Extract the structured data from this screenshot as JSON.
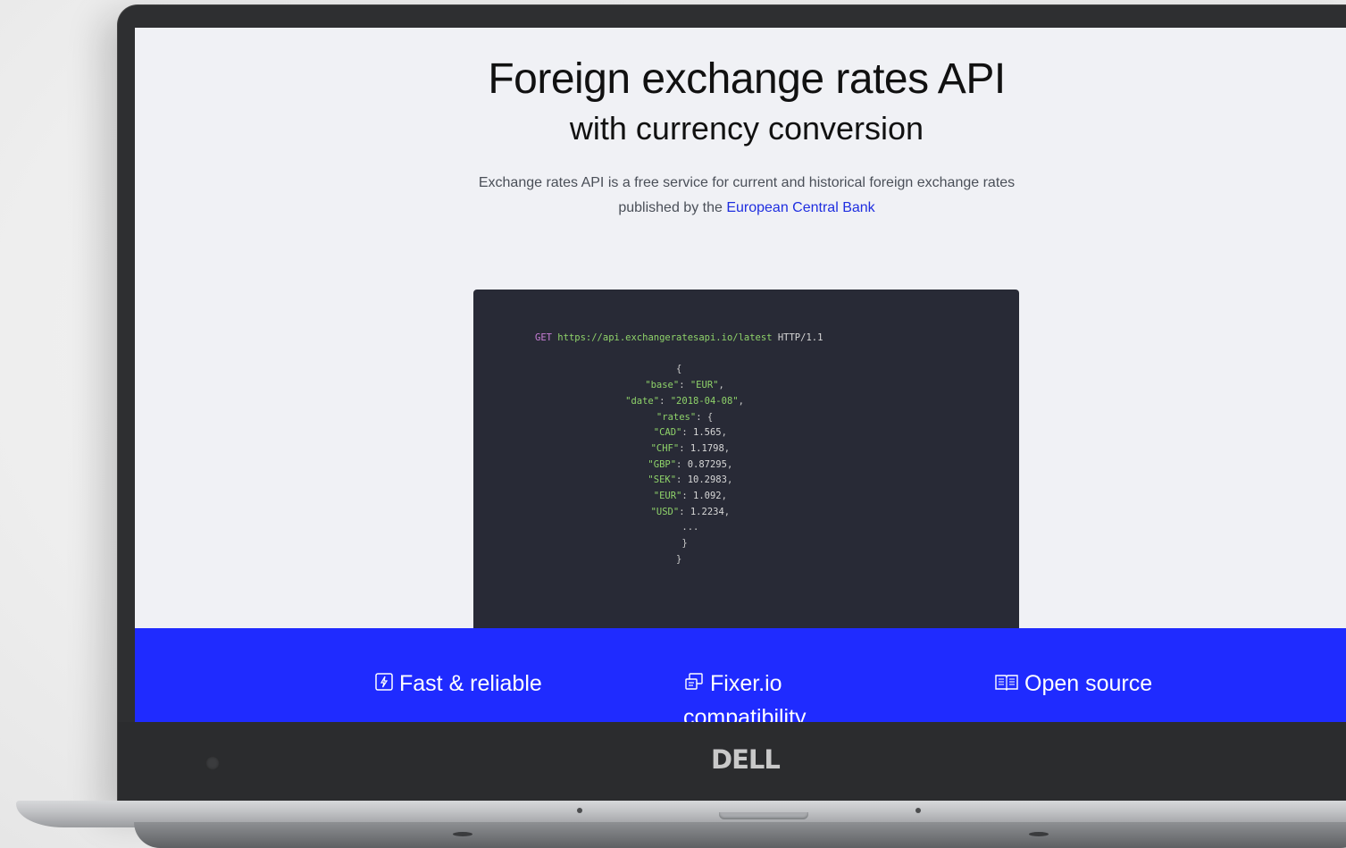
{
  "hero": {
    "title": "Foreign exchange rates API",
    "subtitle": "with currency conversion",
    "description_prefix": "Exchange rates API is a free service for current and historical foreign exchange rates",
    "description_line2_prefix": "published by the ",
    "link_text": "European Central Bank"
  },
  "code": {
    "method": "GET",
    "url": "https://api.exchangeratesapi.io/latest",
    "protocol": "HTTP/1.1",
    "base_key": "\"base\"",
    "base_value": "\"EUR\"",
    "date_key": "\"date\"",
    "date_value": "\"2018-04-08\"",
    "rates_key": "\"rates\"",
    "rates": [
      {
        "key": "\"CAD\"",
        "value": "1.565"
      },
      {
        "key": "\"CHF\"",
        "value": "1.1798"
      },
      {
        "key": "\"GBP\"",
        "value": "0.87295"
      },
      {
        "key": "\"SEK\"",
        "value": "10.2983"
      },
      {
        "key": "\"EUR\"",
        "value": "1.092"
      },
      {
        "key": "\"USD\"",
        "value": "1.2234"
      }
    ],
    "ellipsis": "..."
  },
  "features": [
    {
      "icon": "lightning-icon",
      "title": "Fast & reliable"
    },
    {
      "icon": "cards-icon",
      "title": "Fixer.io",
      "title_line2": "compatibility"
    },
    {
      "icon": "book-icon",
      "title": "Open source"
    }
  ],
  "device": {
    "brand": "DELL"
  },
  "colors": {
    "band": "#1f2bff",
    "link": "#1f2ee0",
    "code_bg": "#282a36",
    "string": "#8fd36a",
    "keyword": "#c77dd6"
  }
}
